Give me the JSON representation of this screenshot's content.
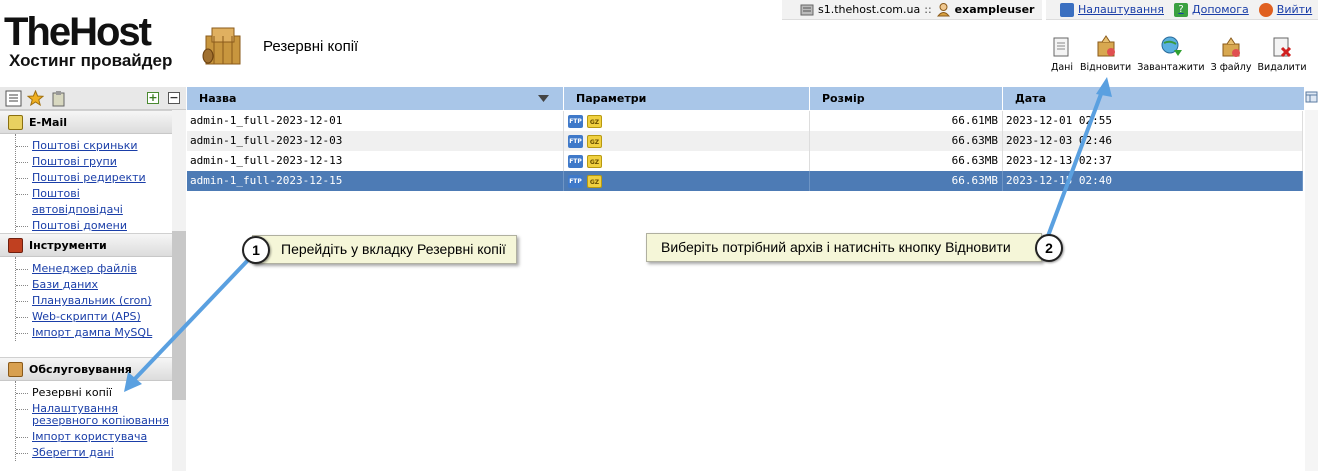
{
  "app": {
    "brand": "TheHost",
    "tagline": "Хостинг провайдер",
    "page_title": "Резервні копії"
  },
  "userbar": {
    "server": "s1.thehost.com.ua",
    "separator": "::",
    "username": "exampleuser"
  },
  "sysbar": {
    "settings": "Налаштування",
    "help": "Допомога",
    "logout": "Вийти"
  },
  "toolbar": {
    "data": "Дані",
    "restore": "Відновити",
    "download": "Завантажити",
    "from_file": "З файлу",
    "delete": "Видалити"
  },
  "sidebar": {
    "groups": [
      {
        "title": "E-Mail",
        "items": [
          "Поштові скриньки",
          "Поштові групи",
          "Поштові редиректи",
          "Поштові автовідповідачі",
          "Поштові домени"
        ]
      },
      {
        "title": "Інструменти",
        "items": [
          "Менеджер файлів",
          "Бази даних",
          "Планувальник (cron)",
          "Web-скрипти (APS)",
          "Імпорт дампа MySQL"
        ]
      },
      {
        "title": "Обслуговування",
        "items": [
          "Резервні копії",
          "Налаштування резервного копіювання",
          "Імпорт користувача",
          "Зберегти дані"
        ]
      }
    ]
  },
  "table": {
    "columns": [
      "Назва",
      "Параметри",
      "Розмір",
      "Дата"
    ],
    "param_badges": [
      "FTP",
      "GZ"
    ],
    "rows": [
      {
        "name": "admin-1_full-2023-12-01",
        "size": "66.61MB",
        "date": "2023-12-01 02:55"
      },
      {
        "name": "admin-1_full-2023-12-03",
        "size": "66.63MB",
        "date": "2023-12-03 02:46"
      },
      {
        "name": "admin-1_full-2023-12-13",
        "size": "66.63MB",
        "date": "2023-12-13 02:37"
      },
      {
        "name": "admin-1_full-2023-12-15",
        "size": "66.63MB",
        "date": "2023-12-15 02:40"
      }
    ]
  },
  "callouts": [
    {
      "number": "1",
      "text": "Перейдіть у вкладку Резервні копії"
    },
    {
      "number": "2",
      "text": "Виберіть потрібний архів і натисніть кнопку Відновити"
    }
  ],
  "colors": {
    "header_blue": "#a9c6e8",
    "selected_row": "#4d7bb5",
    "link": "#1a3ea8",
    "callout_bg": "#f5f6d8",
    "arrow": "#5aa0e0"
  }
}
